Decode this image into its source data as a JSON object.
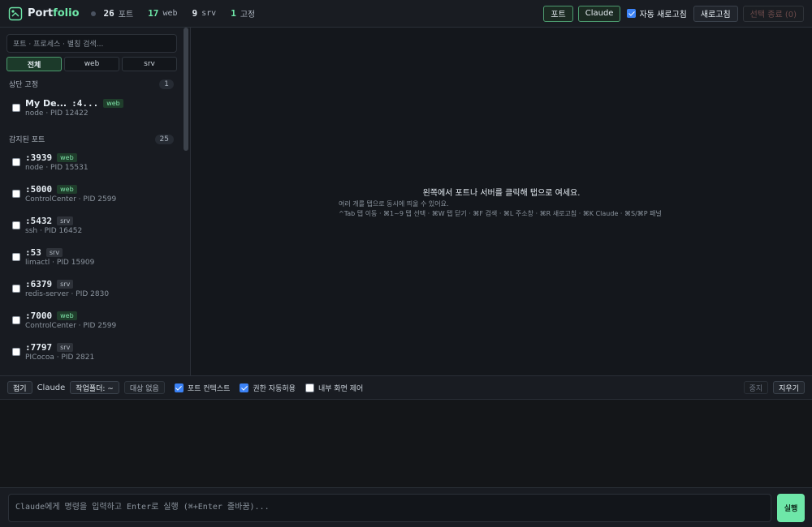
{
  "header": {
    "app_name_part1": "Port",
    "app_name_part2": "folio",
    "stats": [
      {
        "value": "26",
        "label": "포트"
      },
      {
        "value": "17",
        "label": "web"
      },
      {
        "value": "9",
        "label": "srv"
      },
      {
        "value": "1",
        "label": "고정"
      }
    ],
    "btn_ports": "포트",
    "btn_claude": "Claude",
    "auto_refresh_label": "자동 새로고침",
    "auto_refresh_checked": true,
    "btn_refresh": "새로고침",
    "btn_kill_selected": "선택 종료 (0)"
  },
  "sidebar": {
    "search_placeholder": "포트 · 프로세스 · 별칭 검색...",
    "filters": [
      "전체",
      "web",
      "srv"
    ],
    "active_filter": "전체",
    "pinned_title": "상단 고정",
    "pinned_count": "1",
    "pinned": [
      {
        "name": "My De...",
        "port": ":4...",
        "tag": "web",
        "detail": "node · PID 12422"
      }
    ],
    "detected_title": "감지된 포트",
    "detected_count": "25",
    "ports": [
      {
        "port": ":3939",
        "tag": "web",
        "detail": "node · PID 15531"
      },
      {
        "port": ":5000",
        "tag": "web",
        "detail": "ControlCenter · PID 2599"
      },
      {
        "port": ":5432",
        "tag": "srv",
        "detail": "ssh · PID 16452"
      },
      {
        "port": ":53",
        "tag": "srv",
        "detail": "limactl · PID 15909"
      },
      {
        "port": ":6379",
        "tag": "srv",
        "detail": "redis-server · PID 2830"
      },
      {
        "port": ":7000",
        "tag": "web",
        "detail": "ControlCenter · PID 2599"
      },
      {
        "port": ":7797",
        "tag": "srv",
        "detail": "PICocoa · PID 2821"
      }
    ]
  },
  "main": {
    "empty_title": "왼쪽에서 포트나 서버를 클릭해 탭으로 여세요.",
    "empty_line1": "여러 개를 탭으로 동시에 띄울 수 있어요.",
    "empty_line2": "^Tab 탭 이동 · ⌘1~9 탭 선택 · ⌘W 탭 닫기 · ⌘F 검색 · ⌘L 주소창 · ⌘R 새로고침 · ⌘K Claude · ⌘S/⌘P 패널"
  },
  "toolbar": {
    "collapse": "접기",
    "claude_label": "Claude",
    "workdir": "작업폴더: ~",
    "no_target": "대상 없음",
    "port_context": "포트 컨텍스트",
    "port_context_checked": true,
    "auto_permission": "권한 자동허용",
    "auto_permission_checked": true,
    "internal_control": "내부 화면 제어",
    "internal_control_checked": false,
    "stop": "중지",
    "clear": "지우기"
  },
  "command": {
    "placeholder": "Claude에게 명령을 입력하고 Enter로 실행 (⌘+Enter 줄바꿈)...",
    "run": "실행"
  }
}
